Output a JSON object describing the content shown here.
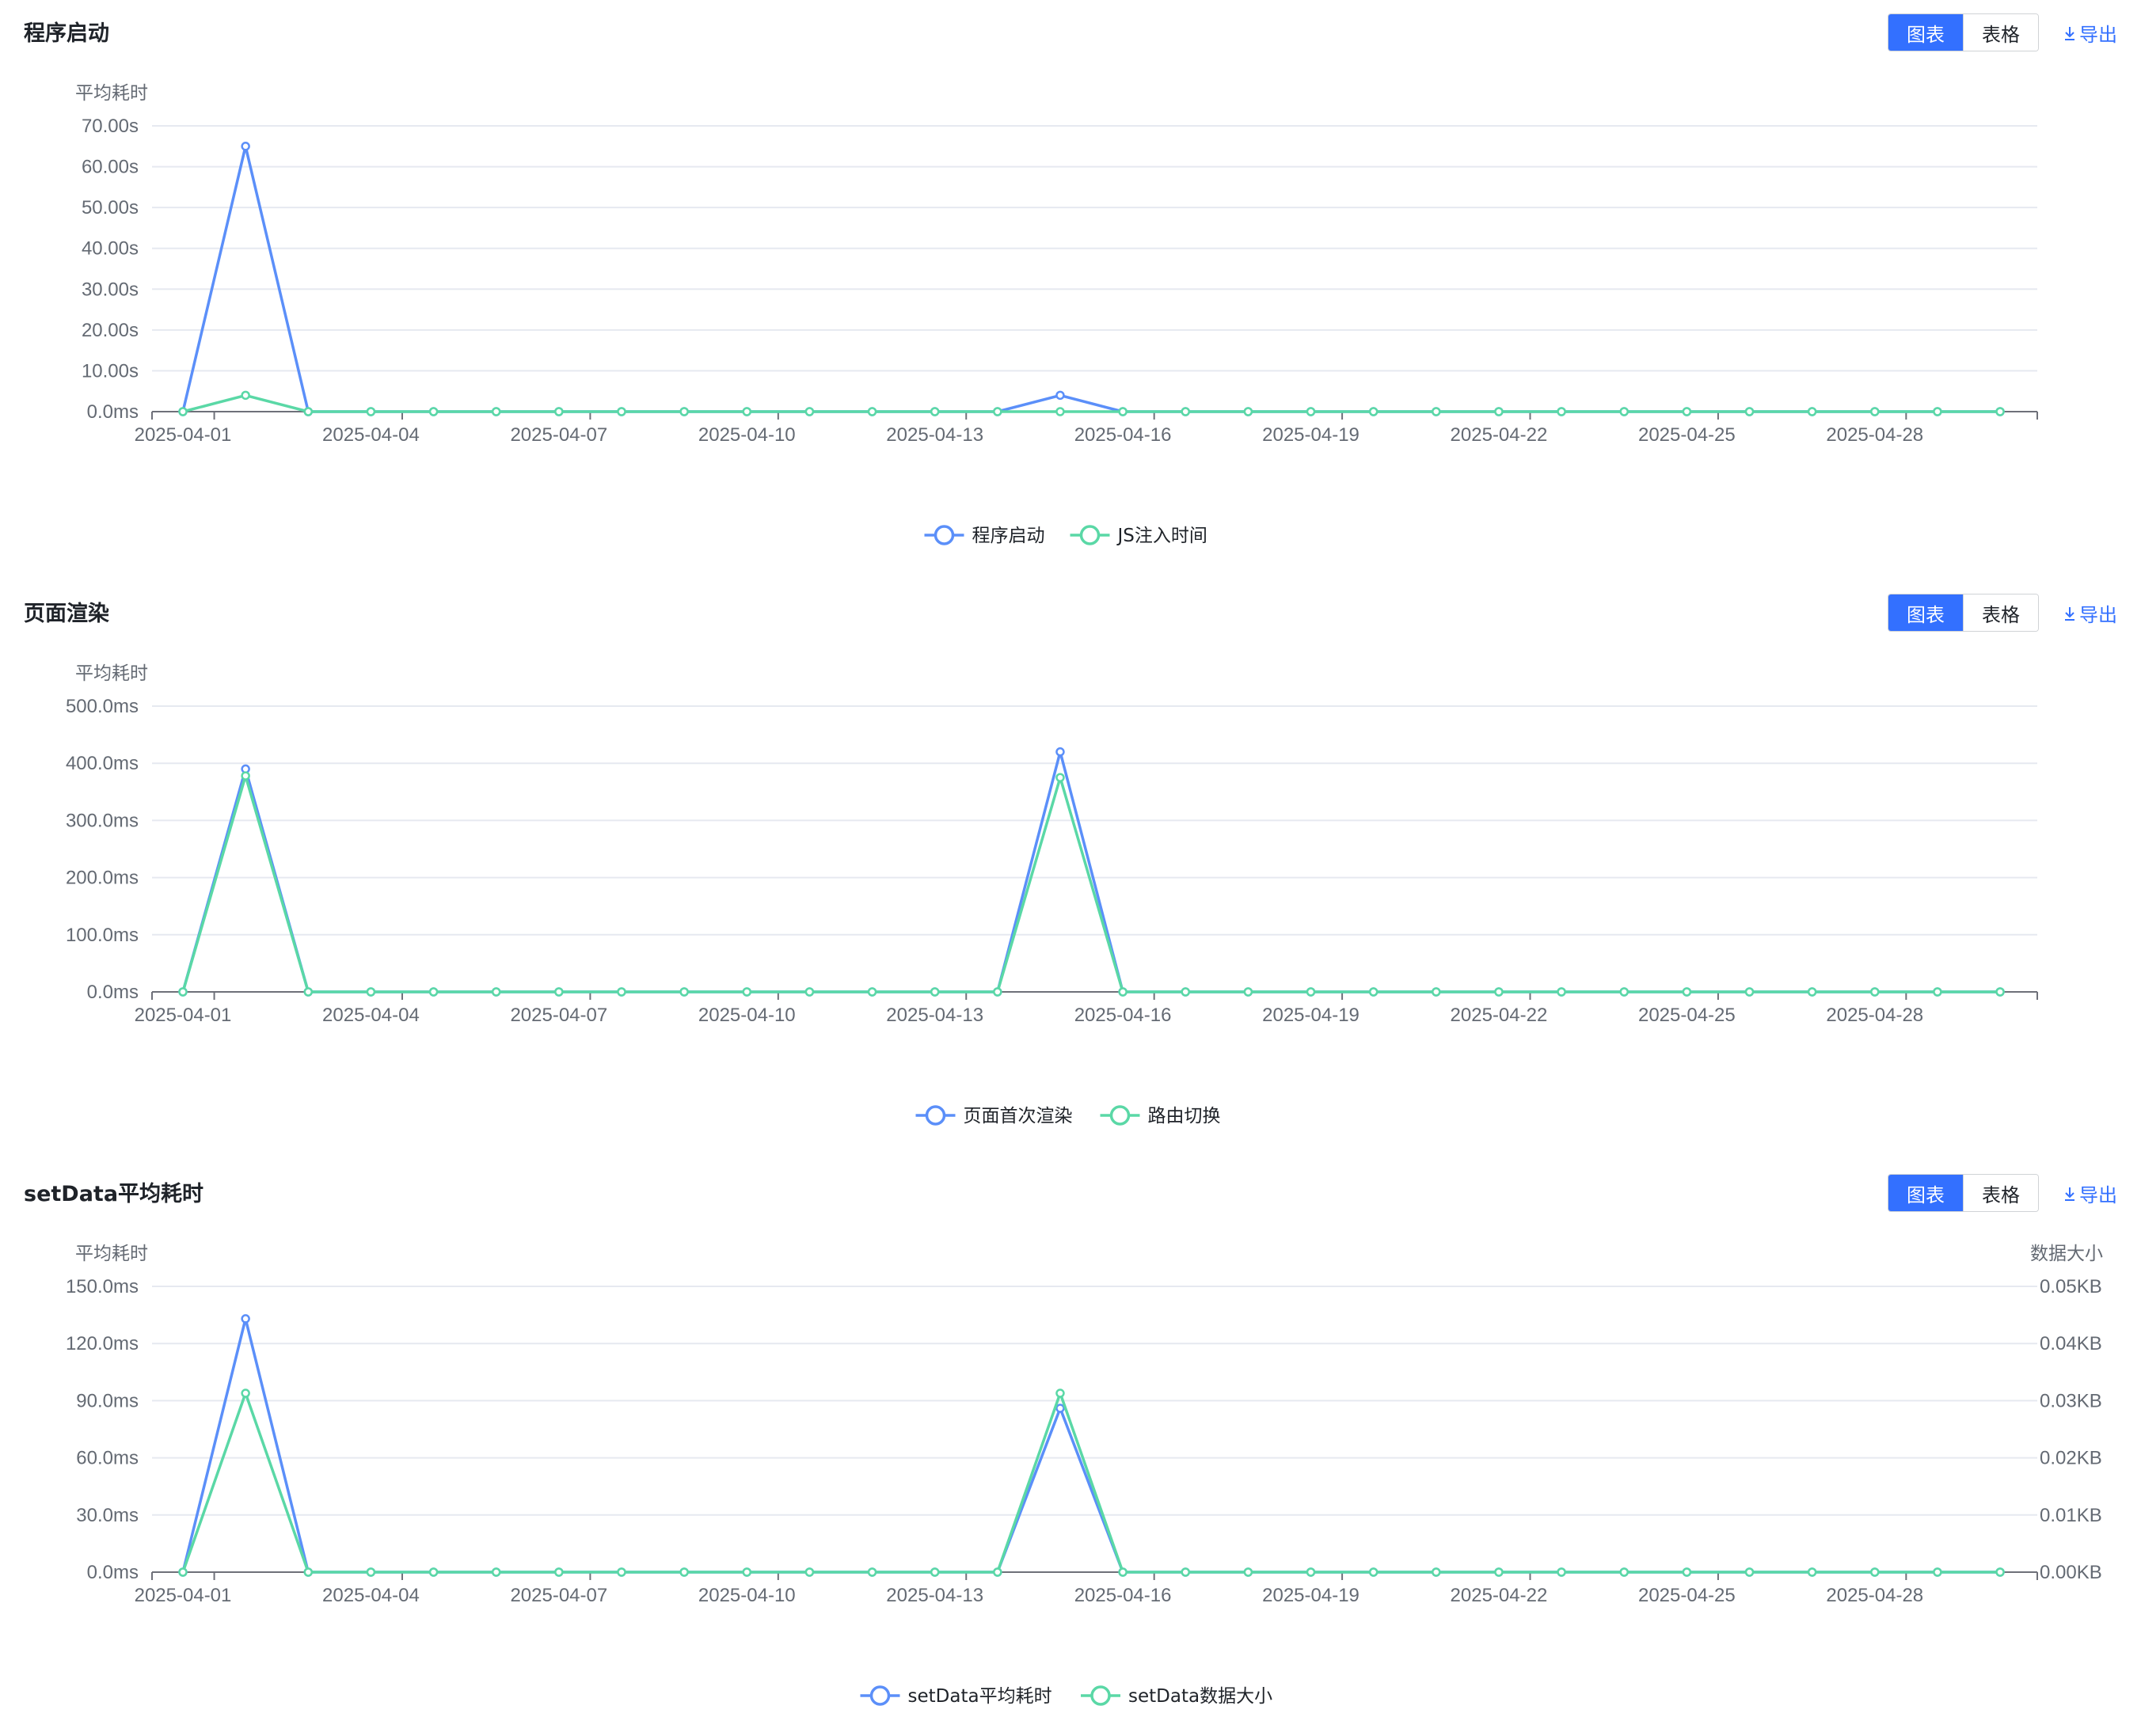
{
  "common": {
    "toggle_chart": "图表",
    "toggle_table": "表格",
    "export_label": "导出",
    "colors": {
      "series1": "#5b8ff9",
      "series2": "#5ad8a6",
      "accent": "#3370ff",
      "grid": "#e6e9f0"
    },
    "x_tick_labels": [
      "2025-04-01",
      "2025-04-04",
      "2025-04-07",
      "2025-04-10",
      "2025-04-13",
      "2025-04-16",
      "2025-04-19",
      "2025-04-22",
      "2025-04-25",
      "2025-04-28"
    ]
  },
  "panels": [
    {
      "title": "程序启动"
    },
    {
      "title": "页面渲染"
    },
    {
      "title": "setData平均耗时"
    }
  ],
  "chart_data": [
    {
      "type": "line",
      "title": "程序启动",
      "x": [
        "2025-04-01",
        "2025-04-02",
        "2025-04-03",
        "2025-04-04",
        "2025-04-05",
        "2025-04-06",
        "2025-04-07",
        "2025-04-08",
        "2025-04-09",
        "2025-04-10",
        "2025-04-11",
        "2025-04-12",
        "2025-04-13",
        "2025-04-14",
        "2025-04-15",
        "2025-04-16",
        "2025-04-17",
        "2025-04-18",
        "2025-04-19",
        "2025-04-20",
        "2025-04-21",
        "2025-04-22",
        "2025-04-23",
        "2025-04-24",
        "2025-04-25",
        "2025-04-26",
        "2025-04-27",
        "2025-04-28",
        "2025-04-29",
        "2025-04-30"
      ],
      "ylabel": "平均耗时",
      "ylim": [
        0,
        70
      ],
      "y_ticks": [
        "0.0ms",
        "10.00s",
        "20.00s",
        "30.00s",
        "40.00s",
        "50.00s",
        "60.00s",
        "70.00s"
      ],
      "y_unit": "s",
      "series": [
        {
          "name": "程序启动",
          "values": [
            0,
            65,
            0,
            0,
            0,
            0,
            0,
            0,
            0,
            0,
            0,
            0,
            0,
            0,
            4,
            0,
            0,
            0,
            0,
            0,
            0,
            0,
            0,
            0,
            0,
            0,
            0,
            0,
            0,
            0
          ]
        },
        {
          "name": "JS注入时间",
          "values": [
            0,
            4,
            0,
            0,
            0,
            0,
            0,
            0,
            0,
            0,
            0,
            0,
            0,
            0,
            0,
            0,
            0,
            0,
            0,
            0,
            0,
            0,
            0,
            0,
            0,
            0,
            0,
            0,
            0,
            0
          ]
        }
      ],
      "grid": true,
      "legend": "bottom"
    },
    {
      "type": "line",
      "title": "页面渲染",
      "x": [
        "2025-04-01",
        "2025-04-02",
        "2025-04-03",
        "2025-04-04",
        "2025-04-05",
        "2025-04-06",
        "2025-04-07",
        "2025-04-08",
        "2025-04-09",
        "2025-04-10",
        "2025-04-11",
        "2025-04-12",
        "2025-04-13",
        "2025-04-14",
        "2025-04-15",
        "2025-04-16",
        "2025-04-17",
        "2025-04-18",
        "2025-04-19",
        "2025-04-20",
        "2025-04-21",
        "2025-04-22",
        "2025-04-23",
        "2025-04-24",
        "2025-04-25",
        "2025-04-26",
        "2025-04-27",
        "2025-04-28",
        "2025-04-29",
        "2025-04-30"
      ],
      "ylabel": "平均耗时",
      "ylim": [
        0,
        500
      ],
      "y_ticks": [
        "0.0ms",
        "100.0ms",
        "200.0ms",
        "300.0ms",
        "400.0ms",
        "500.0ms"
      ],
      "y_unit": "ms",
      "series": [
        {
          "name": "页面首次渲染",
          "values": [
            0,
            390,
            0,
            0,
            0,
            0,
            0,
            0,
            0,
            0,
            0,
            0,
            0,
            0,
            420,
            0,
            0,
            0,
            0,
            0,
            0,
            0,
            0,
            0,
            0,
            0,
            0,
            0,
            0,
            0
          ]
        },
        {
          "name": "路由切换",
          "values": [
            0,
            378,
            0,
            0,
            0,
            0,
            0,
            0,
            0,
            0,
            0,
            0,
            0,
            0,
            375,
            0,
            0,
            0,
            0,
            0,
            0,
            0,
            0,
            0,
            0,
            0,
            0,
            0,
            0,
            0
          ]
        }
      ],
      "grid": true,
      "legend": "bottom"
    },
    {
      "type": "line",
      "title": "setData平均耗时",
      "x": [
        "2025-04-01",
        "2025-04-02",
        "2025-04-03",
        "2025-04-04",
        "2025-04-05",
        "2025-04-06",
        "2025-04-07",
        "2025-04-08",
        "2025-04-09",
        "2025-04-10",
        "2025-04-11",
        "2025-04-12",
        "2025-04-13",
        "2025-04-14",
        "2025-04-15",
        "2025-04-16",
        "2025-04-17",
        "2025-04-18",
        "2025-04-19",
        "2025-04-20",
        "2025-04-21",
        "2025-04-22",
        "2025-04-23",
        "2025-04-24",
        "2025-04-25",
        "2025-04-26",
        "2025-04-27",
        "2025-04-28",
        "2025-04-29",
        "2025-04-30"
      ],
      "ylabel": "平均耗时",
      "ylim": [
        0,
        150
      ],
      "y_ticks": [
        "0.0ms",
        "30.0ms",
        "60.0ms",
        "90.0ms",
        "120.0ms",
        "150.0ms"
      ],
      "y_unit": "ms",
      "y2label": "数据大小",
      "y2lim": [
        0,
        0.05
      ],
      "y2_ticks": [
        "0.00KB",
        "0.01KB",
        "0.02KB",
        "0.03KB",
        "0.04KB",
        "0.05KB"
      ],
      "y2_unit": "KB",
      "series": [
        {
          "name": "setData平均耗时",
          "axis": "left",
          "values": [
            0,
            133,
            0,
            0,
            0,
            0,
            0,
            0,
            0,
            0,
            0,
            0,
            0,
            0,
            86,
            0,
            0,
            0,
            0,
            0,
            0,
            0,
            0,
            0,
            0,
            0,
            0,
            0,
            0,
            0
          ]
        },
        {
          "name": "setData数据大小",
          "axis": "right",
          "values": [
            0,
            0.0313,
            0,
            0,
            0,
            0,
            0,
            0,
            0,
            0,
            0,
            0,
            0,
            0,
            0.0313,
            0,
            0,
            0,
            0,
            0,
            0,
            0,
            0,
            0,
            0,
            0,
            0,
            0,
            0,
            0
          ]
        }
      ],
      "grid": true,
      "legend": "bottom"
    }
  ]
}
